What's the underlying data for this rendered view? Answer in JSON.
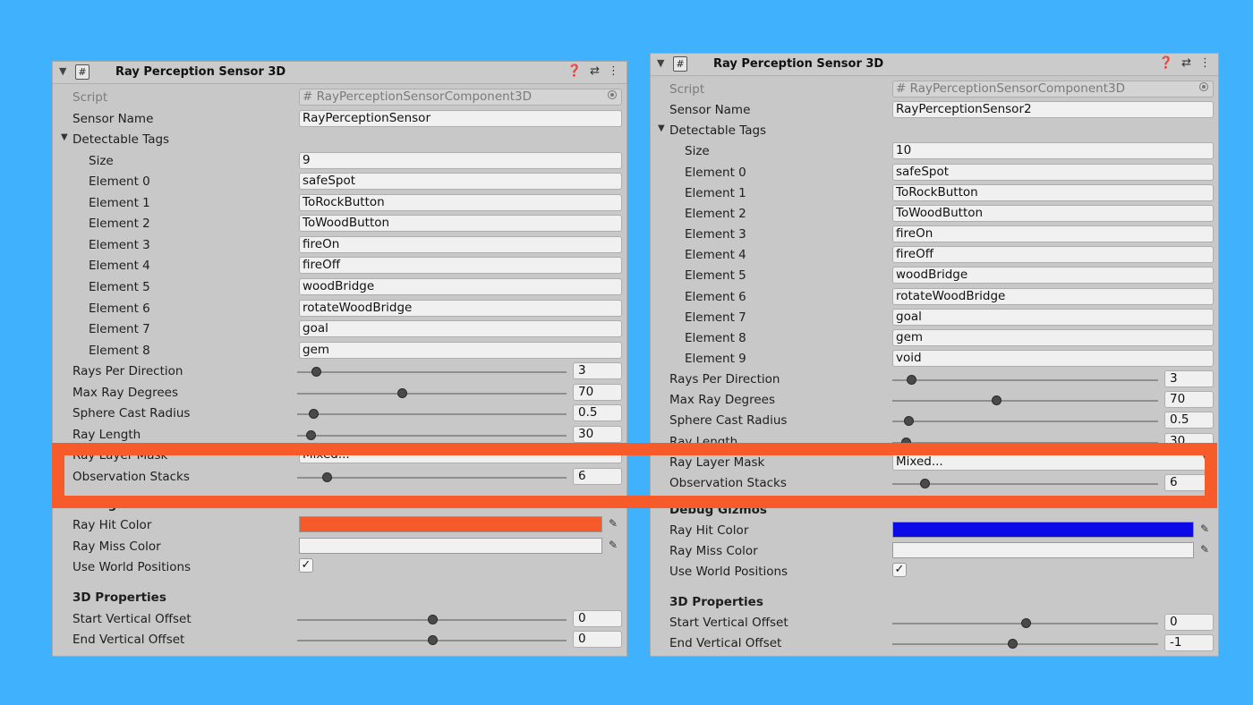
{
  "left": {
    "title": "Ray Perception Sensor 3D",
    "script_label": "Script",
    "script_value": "RayPerceptionSensorComponent3D",
    "sensor_name_label": "Sensor Name",
    "sensor_name_value": "RayPerceptionSensor",
    "tags_label": "Detectable Tags",
    "size_label": "Size",
    "size_value": "9",
    "elements": [
      {
        "label": "Element 0",
        "value": "safeSpot"
      },
      {
        "label": "Element 1",
        "value": "ToRockButton"
      },
      {
        "label": "Element 2",
        "value": "ToWoodButton"
      },
      {
        "label": "Element 3",
        "value": "fireOn"
      },
      {
        "label": "Element 4",
        "value": "fireOff"
      },
      {
        "label": "Element 5",
        "value": "woodBridge"
      },
      {
        "label": "Element 6",
        "value": "rotateWoodBridge"
      },
      {
        "label": "Element 7",
        "value": "goal"
      },
      {
        "label": "Element 8",
        "value": "gem"
      }
    ],
    "sliders": [
      {
        "key": "rays",
        "label": "Rays Per Direction",
        "value": "3",
        "fraction": 0.07
      },
      {
        "key": "maxdeg",
        "label": "Max Ray Degrees",
        "value": "70",
        "fraction": 0.39
      },
      {
        "key": "sphere",
        "label": "Sphere Cast Radius",
        "value": "0.5",
        "fraction": 0.06
      },
      {
        "key": "raylen",
        "label": "Ray Length",
        "value": "30",
        "fraction": 0.05
      }
    ],
    "layer_mask_label": "Ray Layer Mask",
    "layer_mask_value": "Mixed...",
    "obs_stacks": {
      "label": "Observation Stacks",
      "value": "6",
      "fraction": 0.11
    },
    "debug_label": "Debug Gizmos",
    "hit_color_label": "Ray Hit Color",
    "hit_color": "#f65a2a",
    "miss_color_label": "Ray Miss Color",
    "miss_color": "#f1f1f1",
    "world_label": "Use World Positions",
    "world_checked": "✓",
    "props_label": "3D Properties",
    "start_offset": {
      "label": "Start Vertical Offset",
      "value": "0",
      "fraction": 0.5
    },
    "end_offset": {
      "label": "End Vertical Offset",
      "value": "0",
      "fraction": 0.5
    }
  },
  "right": {
    "title": "Ray Perception Sensor 3D",
    "script_label": "Script",
    "script_value": "RayPerceptionSensorComponent3D",
    "sensor_name_label": "Sensor Name",
    "sensor_name_value": "RayPerceptionSensor2",
    "tags_label": "Detectable Tags",
    "size_label": "Size",
    "size_value": "10",
    "elements": [
      {
        "label": "Element 0",
        "value": "safeSpot"
      },
      {
        "label": "Element 1",
        "value": "ToRockButton"
      },
      {
        "label": "Element 2",
        "value": "ToWoodButton"
      },
      {
        "label": "Element 3",
        "value": "fireOn"
      },
      {
        "label": "Element 4",
        "value": "fireOff"
      },
      {
        "label": "Element 5",
        "value": "woodBridge"
      },
      {
        "label": "Element 6",
        "value": "rotateWoodBridge"
      },
      {
        "label": "Element 7",
        "value": "goal"
      },
      {
        "label": "Element 8",
        "value": "gem"
      },
      {
        "label": "Element 9",
        "value": "void"
      }
    ],
    "sliders": [
      {
        "key": "rays",
        "label": "Rays Per Direction",
        "value": "3",
        "fraction": 0.07
      },
      {
        "key": "maxdeg",
        "label": "Max Ray Degrees",
        "value": "70",
        "fraction": 0.39
      },
      {
        "key": "sphere",
        "label": "Sphere Cast Radius",
        "value": "0.5",
        "fraction": 0.06
      },
      {
        "key": "raylen",
        "label": "Ray Length",
        "value": "30",
        "fraction": 0.05
      }
    ],
    "layer_mask_label": "Ray Layer Mask",
    "layer_mask_value": "Mixed...",
    "obs_stacks": {
      "label": "Observation Stacks",
      "value": "6",
      "fraction": 0.12
    },
    "debug_label": "Debug Gizmos",
    "hit_color_label": "Ray Hit Color",
    "hit_color": "#0a0ae6",
    "miss_color_label": "Ray Miss Color",
    "miss_color": "#f1f1f1",
    "world_label": "Use World Positions",
    "world_checked": "✓",
    "props_label": "3D Properties",
    "start_offset": {
      "label": "Start Vertical Offset",
      "value": "0",
      "fraction": 0.5
    },
    "end_offset": {
      "label": "End Vertical Offset",
      "value": "-1",
      "fraction": 0.45
    }
  },
  "colors": {
    "background": "#3fb1fd",
    "highlight": "#f75b2a",
    "panel": "#c8c8c8"
  }
}
